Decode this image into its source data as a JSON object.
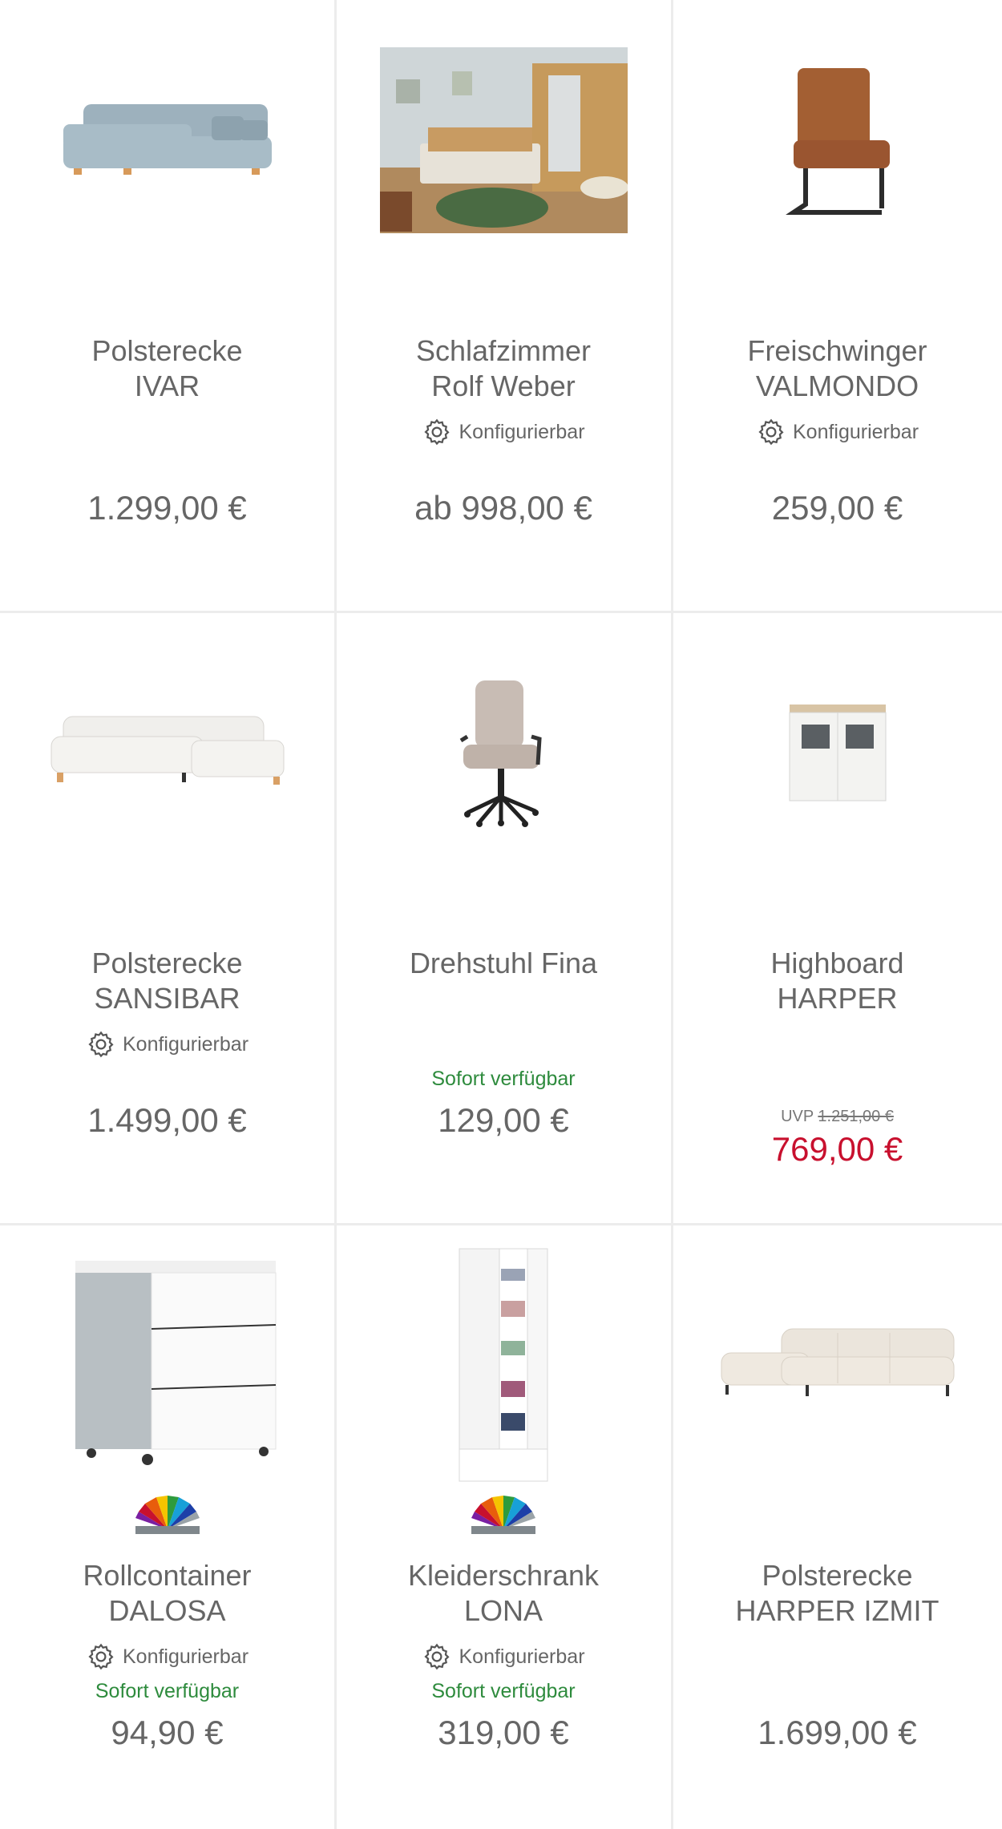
{
  "products": [
    {
      "title_line1": "Polsterecke",
      "title_line2": "IVAR",
      "price": "1.299,00 €",
      "image": "sofa-grey-icon"
    },
    {
      "title_line1": "Schlafzimmer",
      "title_line2": "Rolf Weber",
      "configurable": "Konfigurierbar",
      "price": "ab 998,00 €",
      "image": "bedroom-photo"
    },
    {
      "title_line1": "Freischwinger",
      "title_line2": "VALMONDO",
      "configurable": "Konfigurierbar",
      "price": "259,00 €",
      "image": "chair-icon"
    },
    {
      "title_line1": "Polsterecke",
      "title_line2": "SANSIBAR",
      "configurable": "Konfigurierbar",
      "price": "1.499,00 €",
      "image": "sofa-white-icon"
    },
    {
      "title_line1": "Drehstuhl Fina",
      "availability": "Sofort verfügbar",
      "price": "129,00 €",
      "image": "office-chair-icon"
    },
    {
      "title_line1": "Highboard",
      "title_line2": "HARPER",
      "uvp_label": "UVP",
      "uvp_price": "1.251,00 €",
      "price": "769,00 €",
      "image": "highboard-icon"
    },
    {
      "title_line1": "Rollcontainer",
      "title_line2": "DALOSA",
      "configurable": "Konfigurierbar",
      "availability": "Sofort verfügbar",
      "price": "94,90 €",
      "image": "rollcontainer-icon"
    },
    {
      "title_line1": "Kleiderschrank",
      "title_line2": "LONA",
      "configurable": "Konfigurierbar",
      "availability": "Sofort verfügbar",
      "price": "319,00 €",
      "image": "wardrobe-icon"
    },
    {
      "title_line1": "Polsterecke",
      "title_line2": "HARPER IZMIT",
      "price": "1.699,00 €",
      "image": "sofa-beige-icon"
    }
  ],
  "colors": {
    "availability": "#2e8b3d",
    "sale": "#c8102e",
    "divider": "#ececec",
    "text": "#666666"
  }
}
